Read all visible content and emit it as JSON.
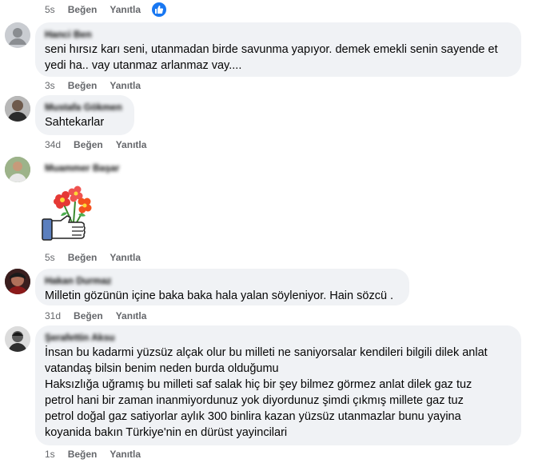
{
  "colors": {
    "bubble": "#f0f2f5",
    "meta": "#65676b",
    "like_blue": "#1877f2"
  },
  "comments": [
    {
      "time": "5s",
      "like": "Beğen",
      "reply": "Yanıtla",
      "reaction": "like-icon"
    },
    {
      "author": "Hanci Ben",
      "text": "seni hırsız karı seni, utanmadan birde savunma yapıyor. demek emekli senin sayende et\nyedi ha.. vay utanmaz arlanmaz vay....",
      "time": "3s",
      "like": "Beğen",
      "reply": "Yanıtla"
    },
    {
      "author": "Mustafa Gökmen",
      "text": "Sahtekarlar",
      "time": "34d",
      "like": "Beğen",
      "reply": "Yanıtla"
    },
    {
      "author": "Muammer Başar",
      "sticker": "flower-thumbs-up-sticker",
      "time": "5s",
      "like": "Beğen",
      "reply": "Yanıtla"
    },
    {
      "author": "Hakan Durmaz",
      "text": "Milletin gözünün içine baka baka hala yalan söyleniyor. Hain sözcü .",
      "time": "31d",
      "like": "Beğen",
      "reply": "Yanıtla"
    },
    {
      "author": "Şerafettin Aksu",
      "text": "İnsan bu kadarmi yüzsüz alçak olur bu milleti ne saniyorsalar kendileri bilgili dilek anlat\nvatandaş bilsin benim neden burda olduğumu\nHaksızlığa uğramış bu milleti saf salak hiç bir şey bilmez görmez anlat dilek gaz tuz\npetrol hani bir zaman inanmiyordunuz yok diyordunuz şimdi çıkmış millete gaz tuz\npetrol doğal gaz satiyorlar aylık 300 binlira kazan yüzsüz utanmazlar bunu yayina\nkoyanida bakın Türkiye'nin en dürüst yayincilari",
      "time": "1s",
      "like": "Beğen",
      "reply": "Yanıtla"
    }
  ]
}
